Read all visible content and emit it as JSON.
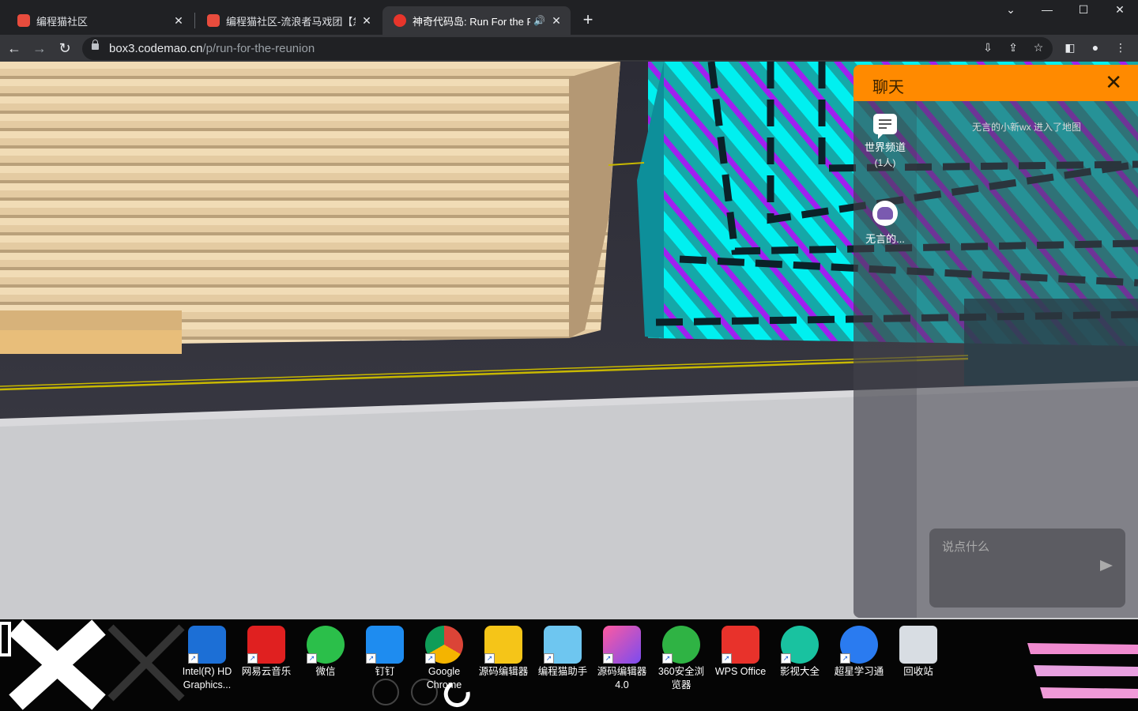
{
  "browser": {
    "tabs": [
      {
        "title": "编程猫社区",
        "favicon_color": "#e84c3d"
      },
      {
        "title": "编程猫社区-流浪者马戏团【急招",
        "favicon_color": "#e84c3d"
      },
      {
        "title": "神奇代码岛: Run For the Re",
        "favicon_color": "#e8352b",
        "active": true
      }
    ],
    "new_tab": "+",
    "url_host": "box3.codemao.cn",
    "url_path": "/p/run-for-the-reunion"
  },
  "chat": {
    "title": "聊天",
    "close": "✕",
    "channels": [
      {
        "label": "世界频道",
        "sub": "(1人)"
      },
      {
        "label": "无言的...",
        "sub": ""
      }
    ],
    "system_message": "无言的小新wx 进入了地图",
    "input_placeholder": "说点什么"
  },
  "desktop": {
    "icons": [
      {
        "label": "Intel(R) HD Graphics...",
        "icon": "intel-graphics-icon"
      },
      {
        "label": "网易云音乐",
        "icon": "netease-music-icon"
      },
      {
        "label": "微信",
        "icon": "wechat-icon"
      },
      {
        "label": "钉钉",
        "icon": "dingtalk-icon"
      },
      {
        "label": "Google Chrome",
        "icon": "chrome-icon"
      },
      {
        "label": "源码编辑器",
        "icon": "code-editor-icon"
      },
      {
        "label": "编程猫助手",
        "icon": "codemao-assistant-icon"
      },
      {
        "label": "源码编辑器 4.0",
        "icon": "code-editor-4-icon"
      },
      {
        "label": "360安全浏览器",
        "icon": "360-browser-icon"
      },
      {
        "label": "WPS Office",
        "icon": "wps-office-icon"
      },
      {
        "label": "影视大全",
        "icon": "video-app-icon"
      },
      {
        "label": "超星学习通",
        "icon": "chaoxing-icon"
      },
      {
        "label": "回收站",
        "icon": "recycle-bin-icon"
      }
    ]
  }
}
